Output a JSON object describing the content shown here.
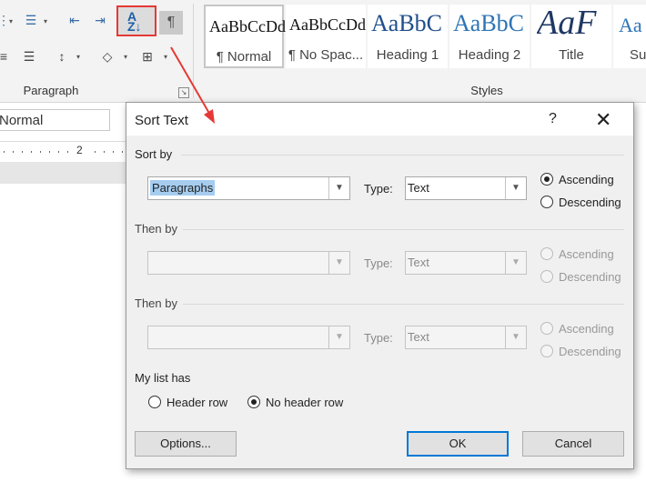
{
  "ribbon": {
    "paragraph_group_label": "Paragraph",
    "styles_group_label": "Styles",
    "pilcrow_glyph": "¶",
    "styles": [
      {
        "preview": "AaBbCcDd",
        "name": "¶ Normal",
        "selected": true
      },
      {
        "preview": "AaBbCcDd",
        "name": "¶ No Spac...",
        "selected": false
      },
      {
        "preview": "AaBbC",
        "name": "Heading 1",
        "selected": false
      },
      {
        "preview": "AaBbC",
        "name": "Heading 2",
        "selected": false
      },
      {
        "preview": "AaF",
        "name": "Title",
        "selected": false
      },
      {
        "preview": "Aa",
        "name": "Sub",
        "selected": false
      }
    ]
  },
  "document": {
    "style_box_value": "Normal",
    "ruler_number": "2"
  },
  "dialog": {
    "title": "Sort Text",
    "help": "?",
    "close": "✕",
    "sort_by": {
      "label": "Sort by",
      "field_value": "Paragraphs",
      "type_label": "Type:",
      "type_value": "Text",
      "ascending": "Ascending",
      "descending": "Descending",
      "selected": "ascending"
    },
    "then_by_1": {
      "label": "Then by",
      "field_value": "",
      "type_label": "Type:",
      "type_value": "Text",
      "ascending": "Ascending",
      "descending": "Descending"
    },
    "then_by_2": {
      "label": "Then by",
      "field_value": "",
      "type_label": "Type:",
      "type_value": "Text",
      "ascending": "Ascending",
      "descending": "Descending"
    },
    "list_has": {
      "label": "My list has",
      "header_row": "Header row",
      "no_header_row": "No header row",
      "selected": "no_header_row"
    },
    "buttons": {
      "options": "Options...",
      "ok": "OK",
      "cancel": "Cancel"
    }
  },
  "colors": {
    "highlight_red": "#e53935",
    "accent_blue": "#0078d7",
    "selection_blue": "#a6cdf0"
  }
}
